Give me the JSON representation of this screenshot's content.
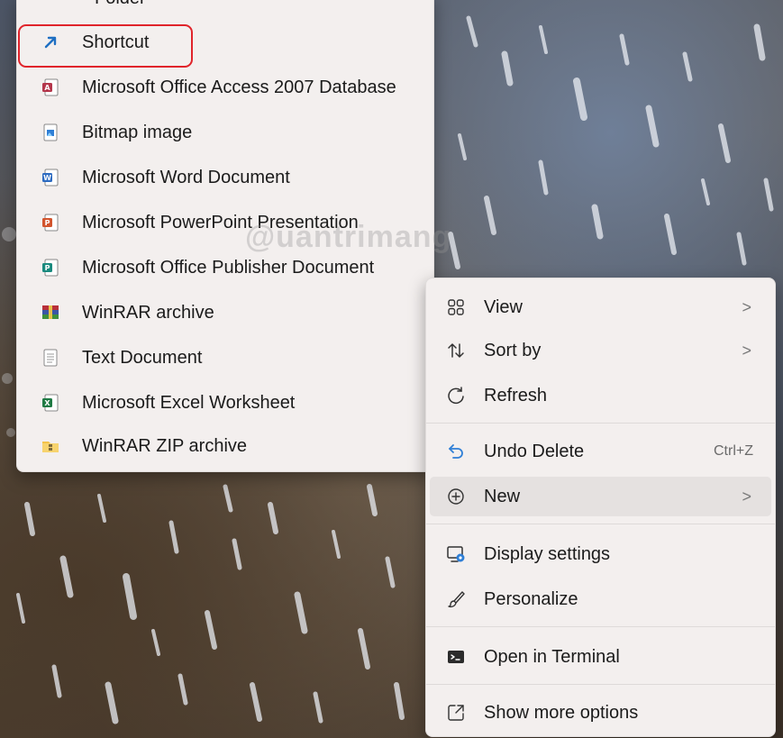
{
  "submenu": {
    "partial_top_label": "Folder",
    "items": [
      {
        "label": "Shortcut",
        "icon": "shortcut-arrow-icon"
      },
      {
        "label": "Microsoft Office Access 2007 Database",
        "icon": "access-file-icon"
      },
      {
        "label": "Bitmap image",
        "icon": "bitmap-file-icon"
      },
      {
        "label": "Microsoft Word Document",
        "icon": "word-file-icon"
      },
      {
        "label": "Microsoft PowerPoint Presentation",
        "icon": "powerpoint-file-icon"
      },
      {
        "label": "Microsoft Office Publisher Document",
        "icon": "publisher-file-icon"
      },
      {
        "label": "WinRAR archive",
        "icon": "winrar-file-icon"
      },
      {
        "label": "Text Document",
        "icon": "text-file-icon"
      },
      {
        "label": "Microsoft Excel Worksheet",
        "icon": "excel-file-icon"
      },
      {
        "label": "WinRAR ZIP archive",
        "icon": "zip-file-icon"
      }
    ]
  },
  "mainmenu": {
    "view": {
      "label": "View",
      "icon": "grid-view-icon",
      "chevron": ">"
    },
    "sort": {
      "label": "Sort by",
      "icon": "sort-arrows-icon",
      "chevron": ">"
    },
    "refresh": {
      "label": "Refresh",
      "icon": "refresh-icon"
    },
    "undo": {
      "label": "Undo Delete",
      "icon": "undo-icon",
      "shortcut": "Ctrl+Z"
    },
    "new": {
      "label": "New",
      "icon": "plus-circle-icon",
      "chevron": ">"
    },
    "display": {
      "label": "Display settings",
      "icon": "display-settings-icon"
    },
    "personalize": {
      "label": "Personalize",
      "icon": "brush-icon"
    },
    "terminal": {
      "label": "Open in Terminal",
      "icon": "terminal-icon"
    },
    "more": {
      "label": "Show more options",
      "icon": "show-more-icon"
    }
  },
  "watermark": "@uantrimang",
  "colors": {
    "highlight": "#e0242b",
    "menu_bg": "#f3efee",
    "hover_bg": "#e5e1e0"
  }
}
